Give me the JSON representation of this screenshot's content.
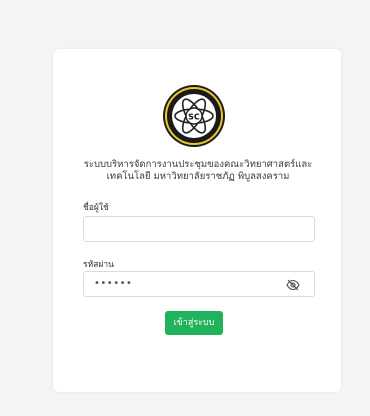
{
  "login": {
    "title_line1": "ระบบบริหารจัดการงานประชุมของคณะวิทยาศาสตร์และ",
    "title_line2": "เทคโนโลยี มหาวิทยาลัยราชภัฏ พิบูลสงคราม",
    "username_label": "ชื่อผู้ใช้",
    "username_value": "",
    "password_label": "รหัสผ่าน",
    "password_value": "••••••",
    "submit_label": "เข้าสู่ระบบ",
    "logo_text": "SC"
  },
  "colors": {
    "background": "#f4f5f2",
    "card": "#ffffff",
    "button": "#21b35c",
    "logo_ring": "#1a1a1a",
    "logo_gold": "#e8c92a"
  },
  "icons": {
    "logo": "faculty-logo-icon",
    "password_toggle": "eye-slash-icon"
  }
}
